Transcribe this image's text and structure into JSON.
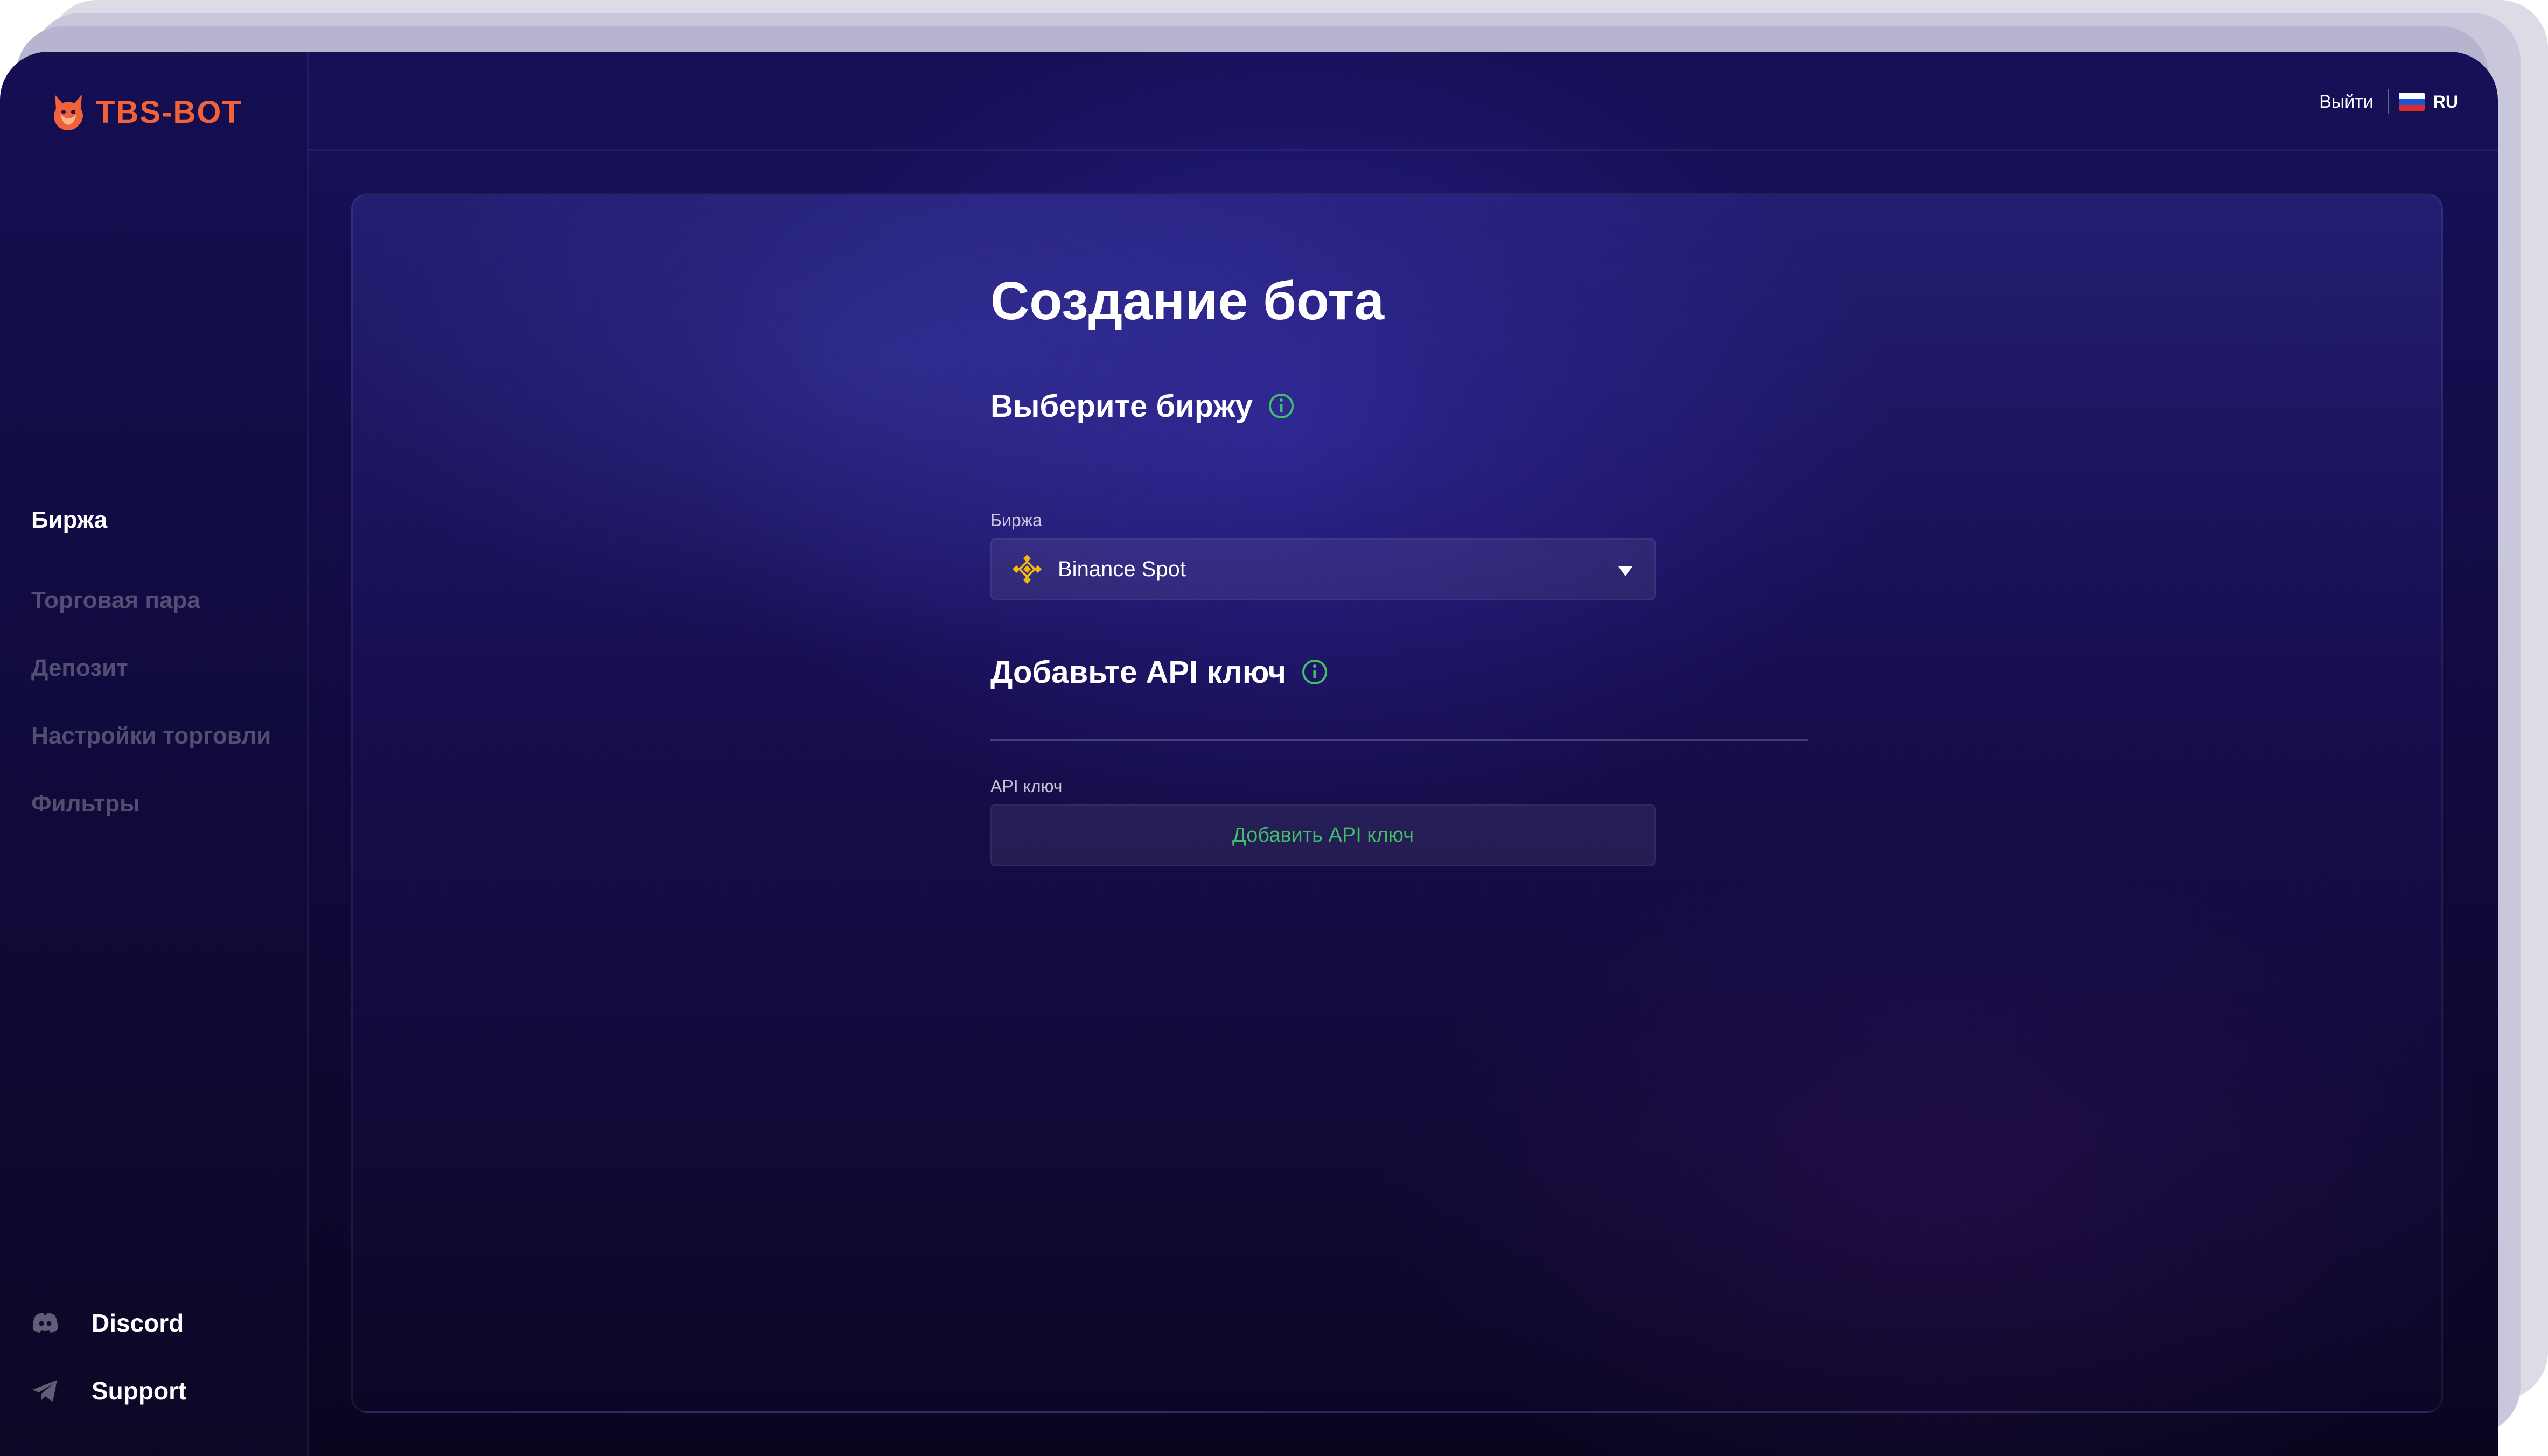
{
  "brand": {
    "name": "TBS-BOT",
    "color": "#f2623a"
  },
  "header": {
    "logout": "Выйти",
    "language": "RU"
  },
  "sidebar": {
    "items": [
      {
        "label": "Биржа",
        "active": true
      },
      {
        "label": "Торговая пара",
        "active": false
      },
      {
        "label": "Депозит",
        "active": false
      },
      {
        "label": "Настройки торговли",
        "active": false
      },
      {
        "label": "Фильтры",
        "active": false
      }
    ],
    "links": [
      {
        "label": "Discord",
        "icon": "discord-icon"
      },
      {
        "label": "Support",
        "icon": "telegram-icon"
      }
    ]
  },
  "main": {
    "title": "Создание бота",
    "exchange_section": {
      "title": "Выберите биржу",
      "field_label": "Биржа",
      "selected": "Binance Spot",
      "selected_icon": "binance-icon"
    },
    "api_section": {
      "title": "Добавьте API ключ",
      "field_label": "API ключ",
      "button": "Добавить API ключ"
    }
  },
  "colors": {
    "accent_green": "#3fbf6a",
    "binance_yellow": "#f0b90b"
  }
}
